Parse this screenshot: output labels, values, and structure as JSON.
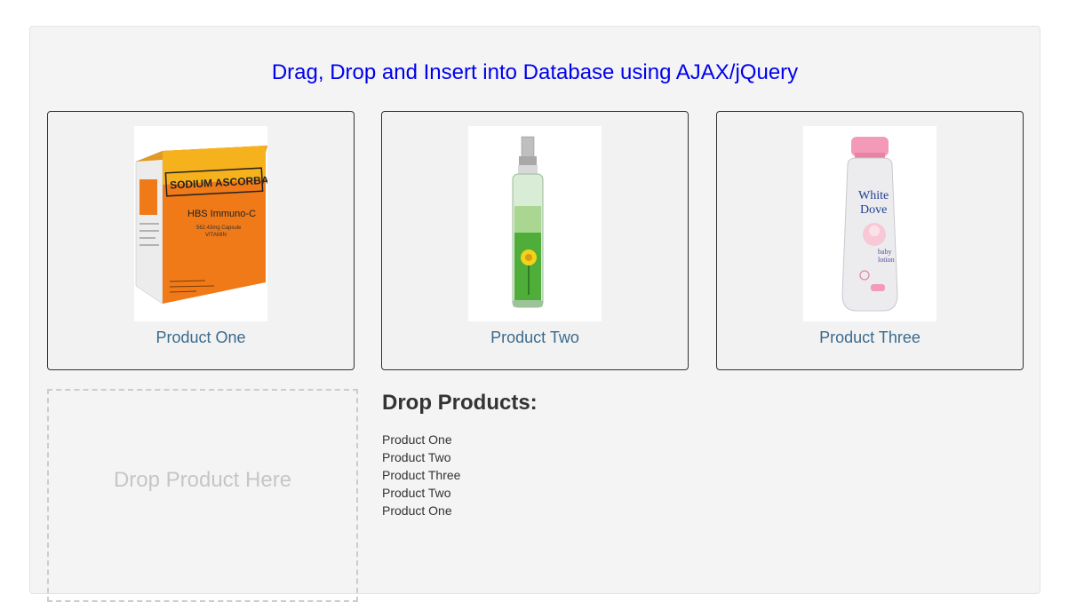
{
  "title": "Drag, Drop and Insert into Database using AJAX/jQuery",
  "products": [
    {
      "name": "Product One",
      "image": "sodium-ascorbate-box-image",
      "image_text": [
        "SODIUM ASCORBATE",
        "HBS Immuno-C",
        "562.43mg Capsule",
        "VITAMIN"
      ]
    },
    {
      "name": "Product Two",
      "image": "body-spray-bottle-image"
    },
    {
      "name": "Product Three",
      "image": "white-dove-lotion-image",
      "image_text": [
        "White",
        "Dove",
        "baby",
        "lotion"
      ]
    }
  ],
  "drop_zone": {
    "hint": "Drop Product Here"
  },
  "dropped": {
    "heading": "Drop Products:",
    "items": [
      "Product One",
      "Product Two",
      "Product Three",
      "Product Two",
      "Product One"
    ]
  },
  "colors": {
    "title": "#0000ee",
    "product_name": "#3b6a8c",
    "hint": "#c6c6c6"
  }
}
